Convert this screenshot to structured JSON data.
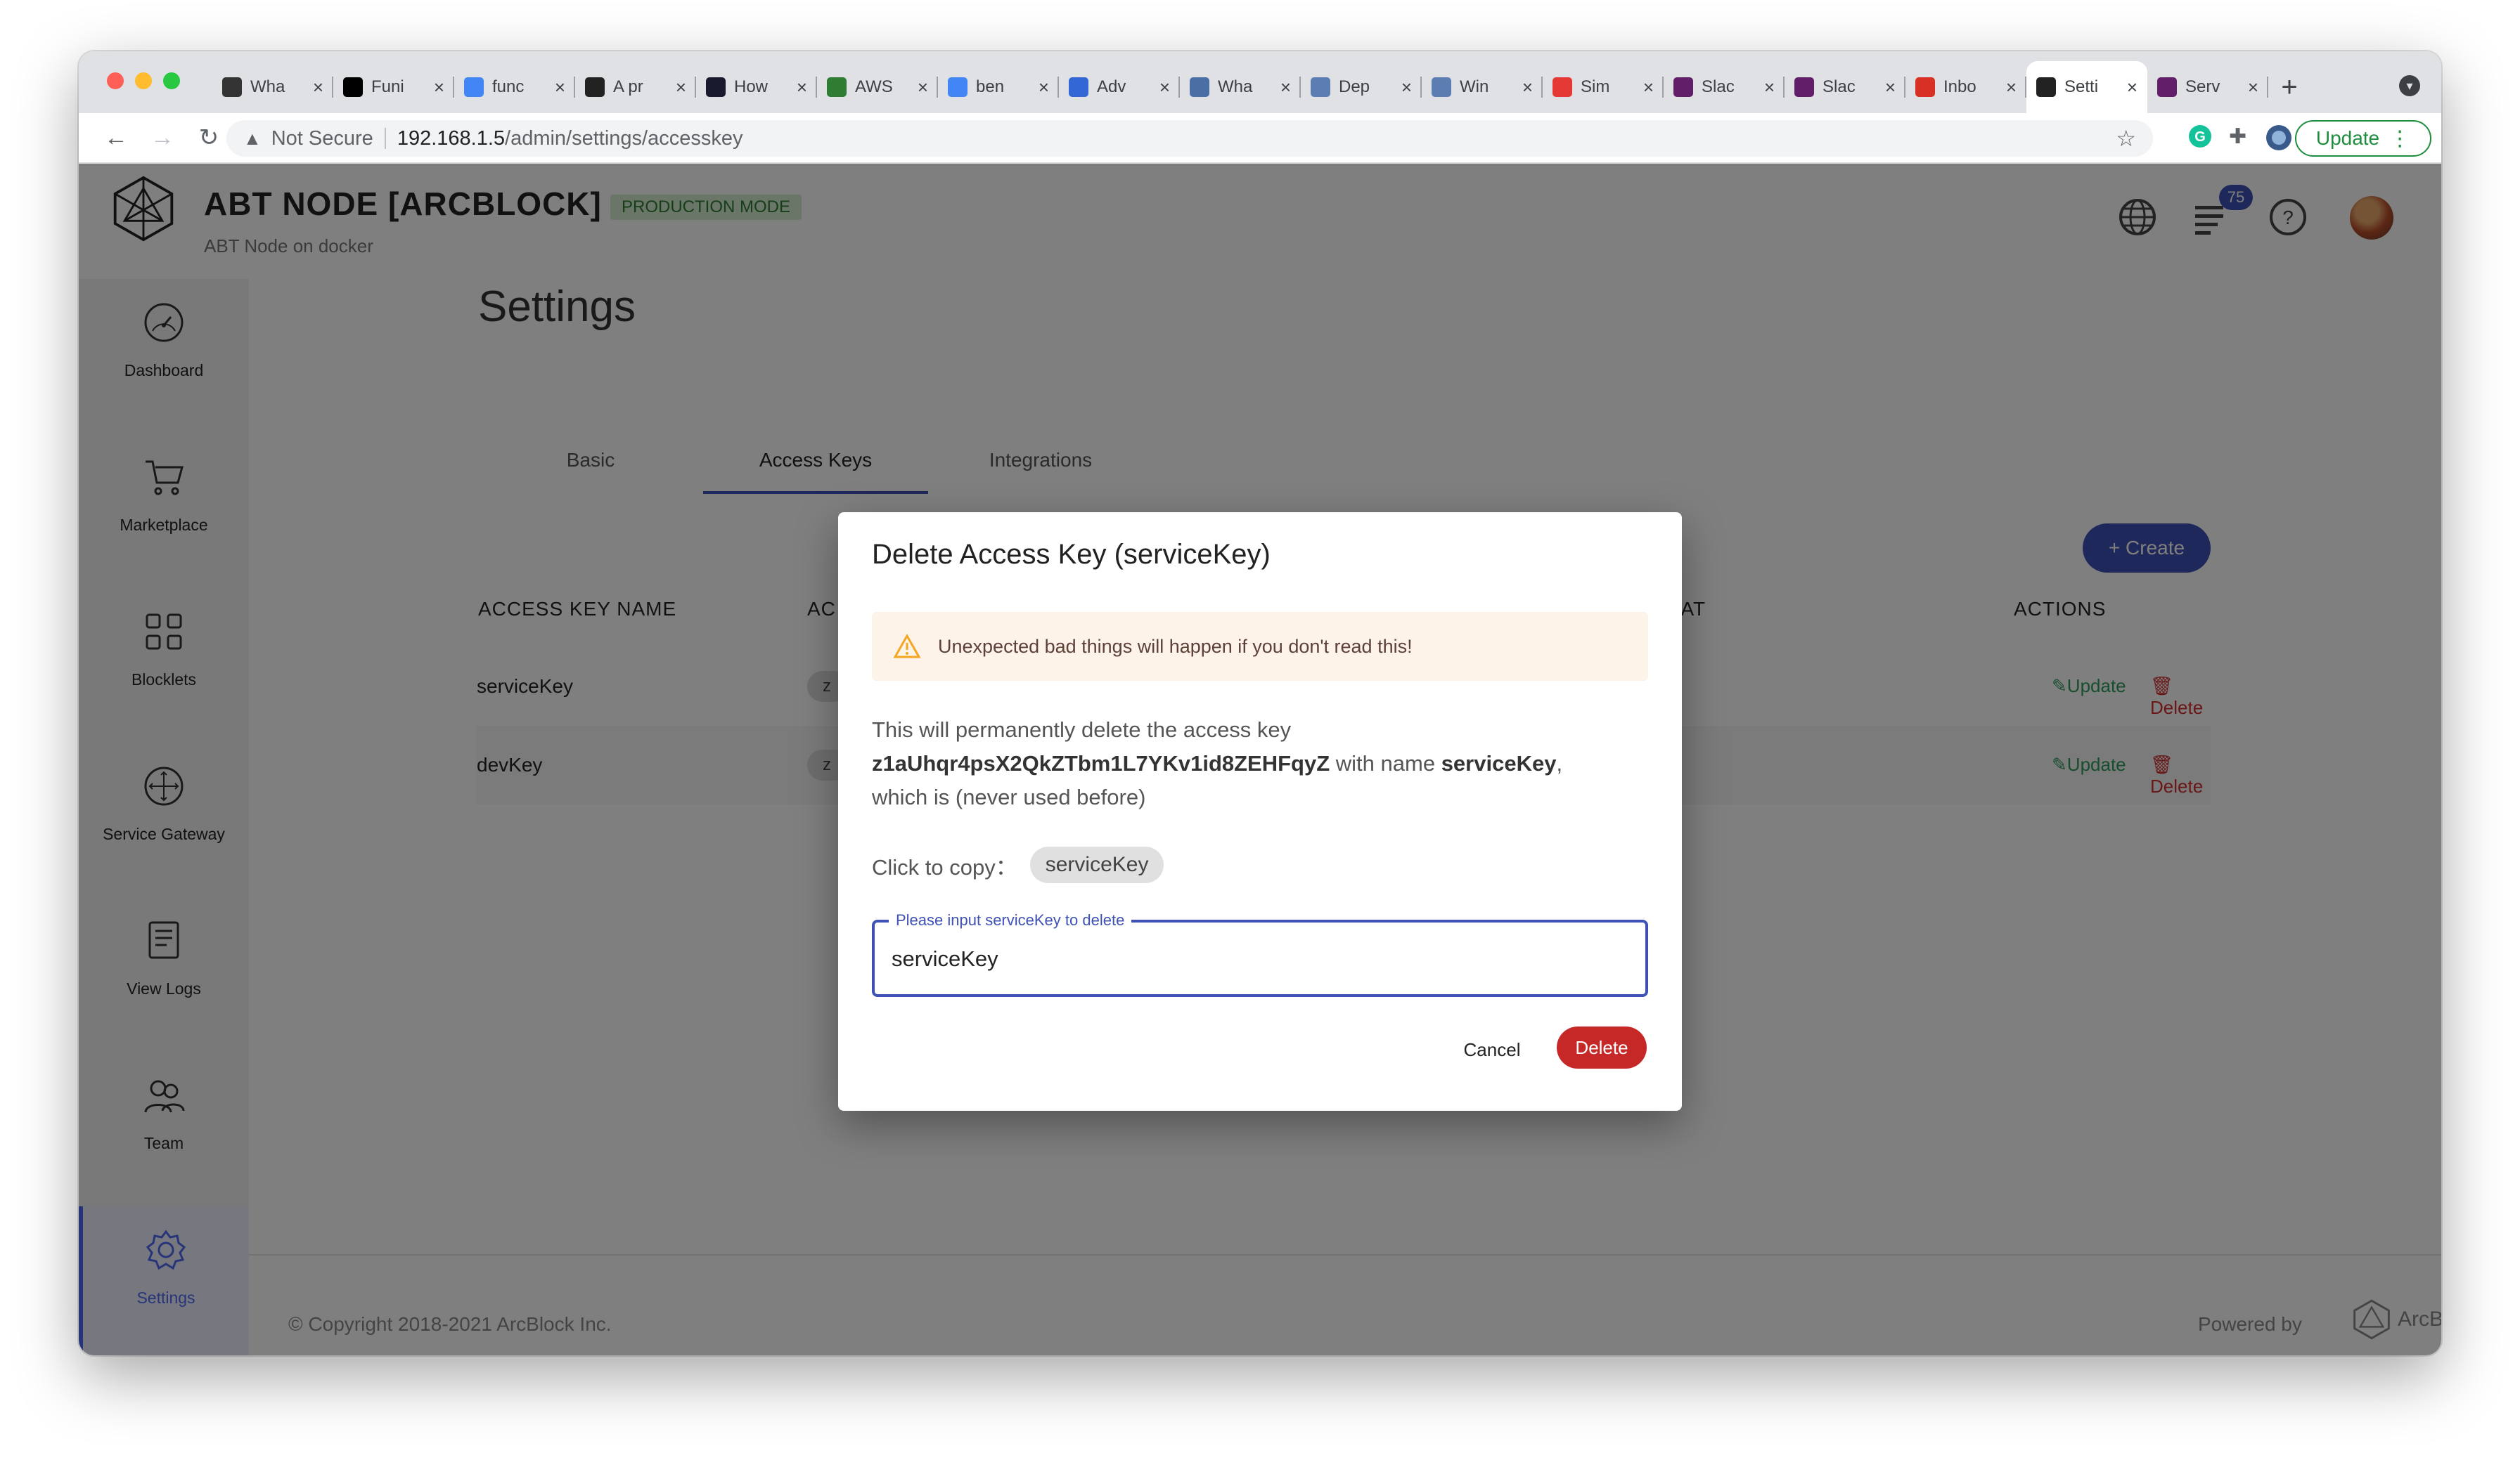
{
  "browser": {
    "tabs": [
      {
        "label": "Wha",
        "icon": "notion-icon",
        "color": "#333333"
      },
      {
        "label": "Funi",
        "icon": "medium-icon",
        "color": "#000000"
      },
      {
        "label": "func",
        "icon": "google-icon",
        "color": "#4285f4"
      },
      {
        "label": "A pr",
        "icon": "page-icon",
        "color": "#222222"
      },
      {
        "label": "How",
        "icon": "a-icon",
        "color": "#1a1a2e"
      },
      {
        "label": "AWS",
        "icon": "doc-icon",
        "color": "#2e7d32"
      },
      {
        "label": "ben",
        "icon": "google-icon",
        "color": "#4285f4"
      },
      {
        "label": "Adv",
        "icon": "link-icon",
        "color": "#3367d6"
      },
      {
        "label": "Wha",
        "icon": "whale-icon",
        "color": "#4a6fa5"
      },
      {
        "label": "Dep",
        "icon": "wave-icon",
        "color": "#5b7db1"
      },
      {
        "label": "Win",
        "icon": "wave-icon",
        "color": "#5b7db1"
      },
      {
        "label": "Sim",
        "icon": "sim-icon",
        "color": "#e53935"
      },
      {
        "label": "Slac",
        "icon": "slack-icon",
        "color": "#611f69"
      },
      {
        "label": "Slac",
        "icon": "slack-icon",
        "color": "#611f69"
      },
      {
        "label": "Inbo",
        "icon": "gmail-icon",
        "color": "#d93025"
      },
      {
        "label": "Setti",
        "icon": "arcblock-icon",
        "color": "#222222",
        "active": true
      },
      {
        "label": "Serv",
        "icon": "slack-icon",
        "color": "#611f69"
      }
    ],
    "url": {
      "security": "Not Secure",
      "host": "192.168.1.5",
      "path": "/admin/settings/accesskey"
    },
    "update_label": "Update"
  },
  "header": {
    "title": "ABT NODE [ARCBLOCK]",
    "mode": "PRODUCTION MODE",
    "subtitle": "ABT Node on docker",
    "notification_count": "75"
  },
  "sidebar": {
    "items": [
      {
        "label": "Dashboard",
        "icon": "dashboard-icon"
      },
      {
        "label": "Marketplace",
        "icon": "cart-icon"
      },
      {
        "label": "Blocklets",
        "icon": "blocklets-icon"
      },
      {
        "label": "Service Gateway",
        "icon": "gateway-icon"
      },
      {
        "label": "View Logs",
        "icon": "logs-icon"
      },
      {
        "label": "Team",
        "icon": "team-icon"
      },
      {
        "label": "Settings",
        "icon": "settings-icon",
        "active": true
      }
    ]
  },
  "main": {
    "title": "Settings",
    "tabs": [
      "Basic",
      "Access Keys",
      "Integrations"
    ],
    "active_tab": "Access Keys",
    "create_label": "+ Create",
    "table": {
      "headers": {
        "name": "ACCESS KEY NAME",
        "key": "AC",
        "date": "D AT",
        "actions": "ACTIONS"
      },
      "rows": [
        {
          "name": "serviceKey",
          "key_partial": "z"
        },
        {
          "name": "devKey",
          "key_partial": "z"
        }
      ],
      "update_label": "Update",
      "delete_label": "Delete"
    }
  },
  "footer": {
    "copyright": "© Copyright 2018-2021  ArcBlock Inc.",
    "powered_by": "Powered by",
    "brand": "ArcBlock"
  },
  "modal": {
    "title": "Delete Access Key (serviceKey)",
    "alert": "Unexpected bad things will happen if you don't read this!",
    "body_prefix": "This will permanently delete the access key",
    "access_key": "z1aUhqr4psX2QkZTbm1L7YKv1id8ZEHFqyZ",
    "body_mid": " with name ",
    "key_name": "serviceKey",
    "body_suffix": ",",
    "body_line3": "which is (never used before)",
    "copy_label": "Click to copy：",
    "copy_chip": "serviceKey",
    "input_label": "Please input serviceKey to delete",
    "input_value": "serviceKey",
    "cancel_label": "Cancel",
    "delete_label": "Delete"
  },
  "colors": {
    "primary": "#3f51b5",
    "danger": "#c62828",
    "success": "#2e9d5a",
    "warning": "#f5a623"
  }
}
